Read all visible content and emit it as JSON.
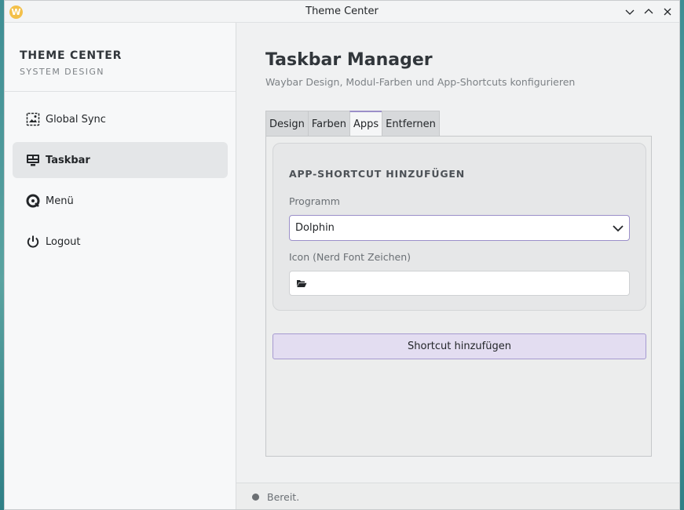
{
  "window": {
    "title": "Theme Center",
    "logo_letter": "W",
    "logo_color": "#f3c04a"
  },
  "sidebar": {
    "brand_title": "THEME CENTER",
    "brand_subtitle": "SYSTEM DESIGN",
    "items": [
      {
        "label": "Global Sync",
        "icon": "image-sync-icon",
        "active": false
      },
      {
        "label": "Taskbar",
        "icon": "taskbar-icon",
        "active": true
      },
      {
        "label": "Menü",
        "icon": "menu-ring-icon",
        "active": false
      },
      {
        "label": "Logout",
        "icon": "power-icon",
        "active": false
      }
    ]
  },
  "main": {
    "title": "Taskbar Manager",
    "subtitle": "Waybar Design, Modul-Farben und App-Shortcuts konfigurieren",
    "tabs": [
      {
        "label": "Design",
        "active": false
      },
      {
        "label": "Farben",
        "active": false
      },
      {
        "label": "Apps",
        "active": true
      },
      {
        "label": "Entfernen",
        "active": false
      }
    ],
    "card": {
      "title": "APP-SHORTCUT HINZUFÜGEN",
      "program_label": "Programm",
      "program_value": "Dolphin",
      "icon_label": "Icon (Nerd Font Zeichen)",
      "icon_value_icon": "folder-open-icon"
    },
    "add_button_label": "Shortcut hinzufügen"
  },
  "status": {
    "text": "Bereit."
  },
  "colors": {
    "accent": "#9b8fc9",
    "button_bg": "#e3ddf1",
    "window_bg": "#eff0f1",
    "desktop": "#3e8e94"
  }
}
